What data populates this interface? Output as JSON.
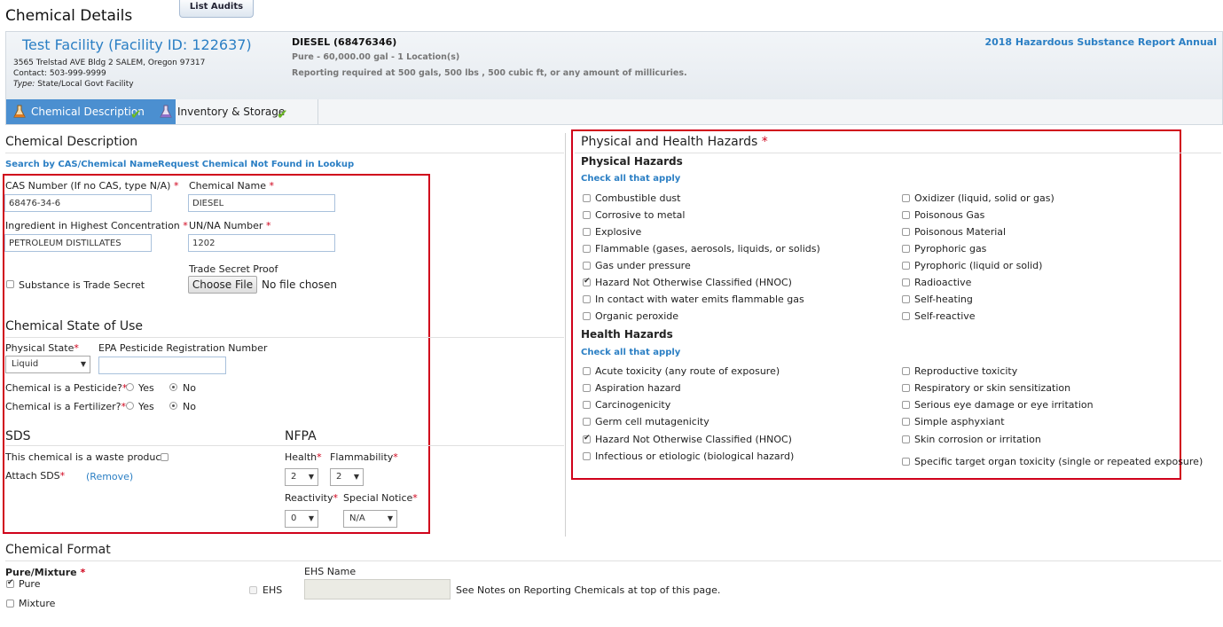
{
  "page": {
    "title": "Chemical Details",
    "list_audits": "List Audits"
  },
  "facility": {
    "name": "Test Facility (Facility ID: 122637)",
    "address": "3565 Trelstad AVE Bldg 2 SALEM, Oregon 97317",
    "contact": "Contact: 503-999-9999",
    "type_label": "Type:",
    "type_value": "State/Local Govt Facility"
  },
  "chemical": {
    "title": "DIESEL (68476346)",
    "summary": "Pure - 60,000.00 gal - 1 Location(s)",
    "reporting": "Reporting required at 500 gals, 500 lbs , 500 cubic ft, or any amount of millicuries."
  },
  "report_link": "2018 Hazardous Substance Report Annual",
  "tabs": [
    {
      "label": "Chemical Description",
      "active": true,
      "icon": "flask-icon",
      "complete": true
    },
    {
      "label": "Inventory & Storage",
      "active": false,
      "icon": "flask-icon",
      "complete": true
    }
  ],
  "description": {
    "heading": "Chemical Description",
    "search_link": "Search by CAS/Chemical Name",
    "request_link": "Request Chemical Not Found in Lookup",
    "cas_label": "CAS Number (If no CAS, type N/A)",
    "cas_value": "68476-34-6",
    "name_label": "Chemical Name",
    "name_value": "DIESEL",
    "ingredient_label": "Ingredient in Highest Concentration",
    "ingredient_value": "PETROLEUM DISTILLATES",
    "un_label": "UN/NA Number",
    "un_value": "1202",
    "trade_secret_label": "Substance is Trade Secret",
    "trade_proof_label": "Trade Secret Proof",
    "choose_file": "Choose File",
    "no_file": "No file chosen"
  },
  "state": {
    "heading": "Chemical State of Use",
    "physical_label": "Physical State",
    "physical_value": "Liquid",
    "epa_label": "EPA Pesticide Registration Number",
    "epa_value": "",
    "pesticide_label": "Chemical is a Pesticide?",
    "fertilizer_label": "Chemical is a Fertilizer?",
    "yes": "Yes",
    "no": "No"
  },
  "sds": {
    "heading": "SDS",
    "waste_label": "This chemical is a waste product",
    "attach_label": "Attach SDS",
    "remove": "(Remove)"
  },
  "nfpa": {
    "heading": "NFPA",
    "health_label": "Health",
    "health_value": "2",
    "flam_label": "Flammability",
    "flam_value": "2",
    "react_label": "Reactivity",
    "react_value": "0",
    "special_label": "Special Notice",
    "special_value": "N/A"
  },
  "hazards": {
    "heading": "Physical and Health Hazards",
    "physical_heading": "Physical Hazards",
    "health_heading": "Health Hazards",
    "check_all": "Check all that apply",
    "physical_left": [
      {
        "label": "Combustible dust",
        "checked": false
      },
      {
        "label": "Corrosive to metal",
        "checked": false
      },
      {
        "label": "Explosive",
        "checked": false
      },
      {
        "label": "Flammable (gases, aerosols, liquids, or solids)",
        "checked": false
      },
      {
        "label": "Gas under pressure",
        "checked": false
      },
      {
        "label": "Hazard Not Otherwise Classified (HNOC)",
        "checked": true
      },
      {
        "label": "In contact with water emits flammable gas",
        "checked": false
      },
      {
        "label": "Organic peroxide",
        "checked": false
      }
    ],
    "physical_right": [
      {
        "label": "Oxidizer (liquid, solid or gas)",
        "checked": false
      },
      {
        "label": "Poisonous Gas",
        "checked": false
      },
      {
        "label": "Poisonous Material",
        "checked": false
      },
      {
        "label": "Pyrophoric gas",
        "checked": false
      },
      {
        "label": "Pyrophoric (liquid or solid)",
        "checked": false
      },
      {
        "label": "Radioactive",
        "checked": false
      },
      {
        "label": "Self-heating",
        "checked": false
      },
      {
        "label": "Self-reactive",
        "checked": false
      }
    ],
    "health_left": [
      {
        "label": "Acute toxicity (any route of exposure)",
        "checked": false
      },
      {
        "label": "Aspiration hazard",
        "checked": false
      },
      {
        "label": "Carcinogenicity",
        "checked": false
      },
      {
        "label": "Germ cell mutagenicity",
        "checked": false
      },
      {
        "label": "Hazard Not Otherwise Classified (HNOC)",
        "checked": true
      },
      {
        "label": "Infectious or etiologic (biological hazard)",
        "checked": false
      }
    ],
    "health_right": [
      {
        "label": "Reproductive toxicity",
        "checked": false
      },
      {
        "label": "Respiratory or skin sensitization",
        "checked": false
      },
      {
        "label": "Serious eye damage or eye irritation",
        "checked": false
      },
      {
        "label": "Simple asphyxiant",
        "checked": false
      },
      {
        "label": "Skin corrosion or irritation",
        "checked": false
      },
      {
        "label": "Specific target organ toxicity (single or repeated exposure)",
        "checked": false
      }
    ]
  },
  "format": {
    "heading": "Chemical Format",
    "pure_mixture_label": "Pure/Mixture",
    "pure": "Pure",
    "mixture": "Mixture",
    "ehs": "EHS",
    "ehs_name_label": "EHS Name",
    "ehs_name_value": "",
    "notes": "See Notes on Reporting Chemicals at top of this page."
  },
  "colors": {
    "link": "#2b7fc4",
    "active_tab": "#4b8fd0",
    "required": "#d0021b",
    "check": "#6ab623"
  }
}
